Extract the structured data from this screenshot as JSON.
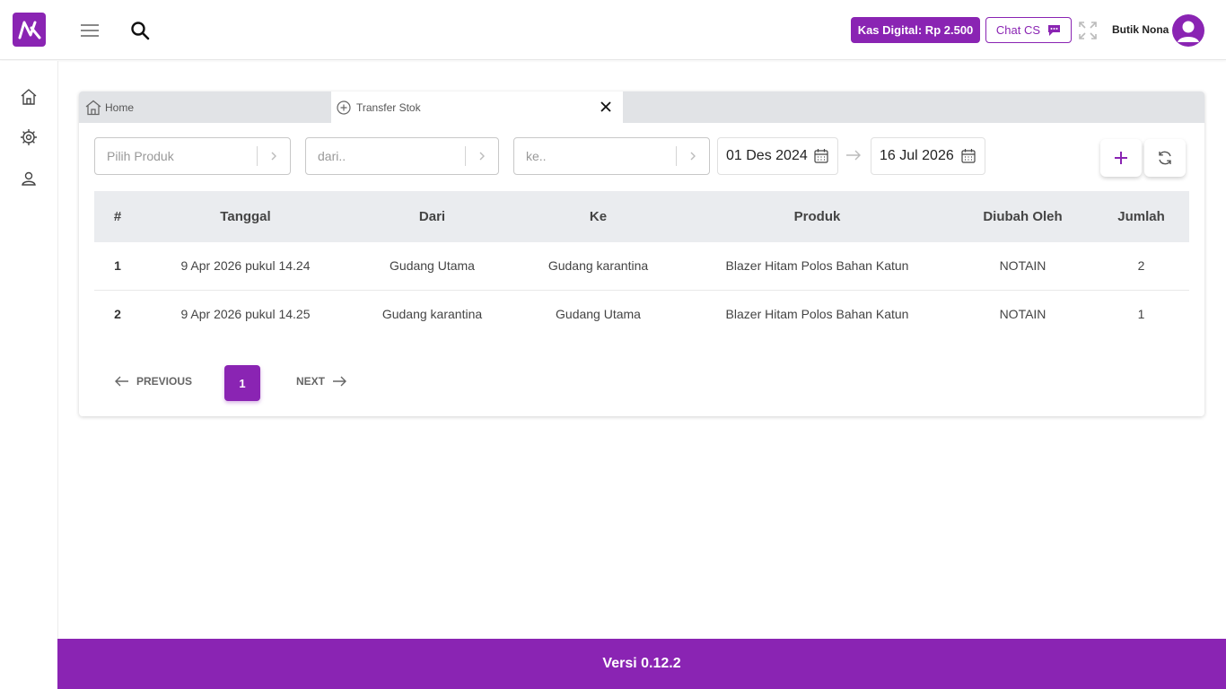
{
  "header": {
    "kas_label": "Kas Digital: Rp 2.500",
    "chat_label": "Chat CS",
    "user_name": "Butik Nona"
  },
  "colors": {
    "accent": "#8a24b3"
  },
  "sidebar": {
    "items": [
      {
        "icon": "home-icon"
      },
      {
        "icon": "settings-gear-icon"
      },
      {
        "icon": "user-icon"
      }
    ]
  },
  "tabs": [
    {
      "label": "Home",
      "icon": "home-icon"
    },
    {
      "label": "Transfer Stok",
      "icon": "plus-circle-icon",
      "active": true
    }
  ],
  "filters": {
    "produk_placeholder": "Pilih Produk",
    "dari_placeholder": "dari..",
    "ke_placeholder": "ke..",
    "date_from": "01 Des 2024",
    "date_to": "16 Jul 2026"
  },
  "table": {
    "headers": [
      "#",
      "Tanggal",
      "Dari",
      "Ke",
      "Produk",
      "Diubah Oleh",
      "Jumlah"
    ],
    "rows": [
      [
        "1",
        "9 Apr 2026 pukul 14.24",
        "Gudang Utama",
        "Gudang karantina",
        "Blazer Hitam Polos Bahan Katun",
        "NOTAIN",
        "2"
      ],
      [
        "2",
        "9 Apr 2026 pukul 14.25",
        "Gudang karantina",
        "Gudang Utama",
        "Blazer Hitam Polos Bahan Katun",
        "NOTAIN",
        "1"
      ]
    ]
  },
  "pagination": {
    "prev_label": "PREVIOUS",
    "current_page": "1",
    "next_label": "NEXT"
  },
  "footer": {
    "version": "Versi 0.12.2"
  }
}
